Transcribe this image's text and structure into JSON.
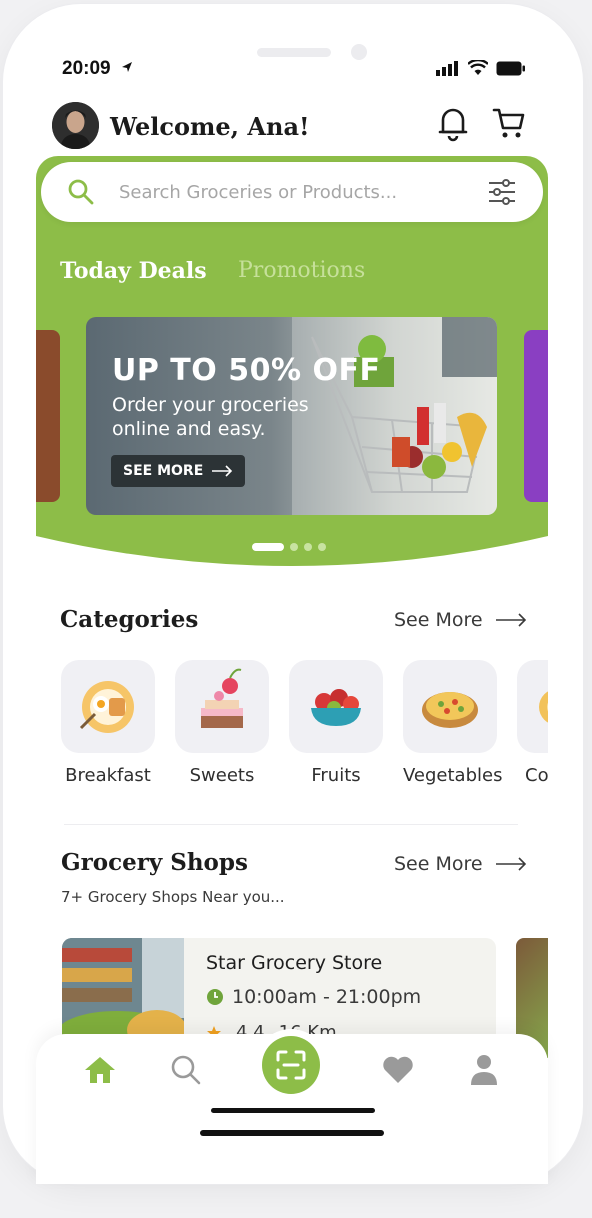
{
  "status_bar": {
    "time": "20:09"
  },
  "header": {
    "welcome": "Welcome, Ana!"
  },
  "search": {
    "placeholder": "Search Groceries or Products..."
  },
  "tabs": [
    {
      "label": "Today Deals",
      "active": true
    },
    {
      "label": "Promotions",
      "active": false
    }
  ],
  "banner": {
    "title": "UP TO  50% OFF",
    "subtitle": "Order your groceries online and easy.",
    "button": "SEE MORE",
    "pages": 4,
    "active_page": 1
  },
  "categories": {
    "title": "Categories",
    "see_more": "See More",
    "items": [
      {
        "label": "Breakfast",
        "icon": "breakfast-plate-icon"
      },
      {
        "label": "Sweets",
        "icon": "cake-icon"
      },
      {
        "label": "Fruits",
        "icon": "fruit-bowl-icon"
      },
      {
        "label": "Vegetables",
        "icon": "vegetable-dish-icon"
      },
      {
        "label": "Co",
        "icon": "partial-category-icon"
      }
    ]
  },
  "shops": {
    "title": "Grocery Shops",
    "see_more": "See More",
    "subtitle": "7+ Grocery Shops Near you...",
    "items": [
      {
        "name": "Star Grocery Store",
        "hours": "10:00am - 21:00pm",
        "rating": "4.4",
        "distance": "16 Km"
      }
    ]
  },
  "colors": {
    "accent": "#8dbd48",
    "accent_light": "#c6e09a",
    "text_dark": "#1d1d1d"
  }
}
